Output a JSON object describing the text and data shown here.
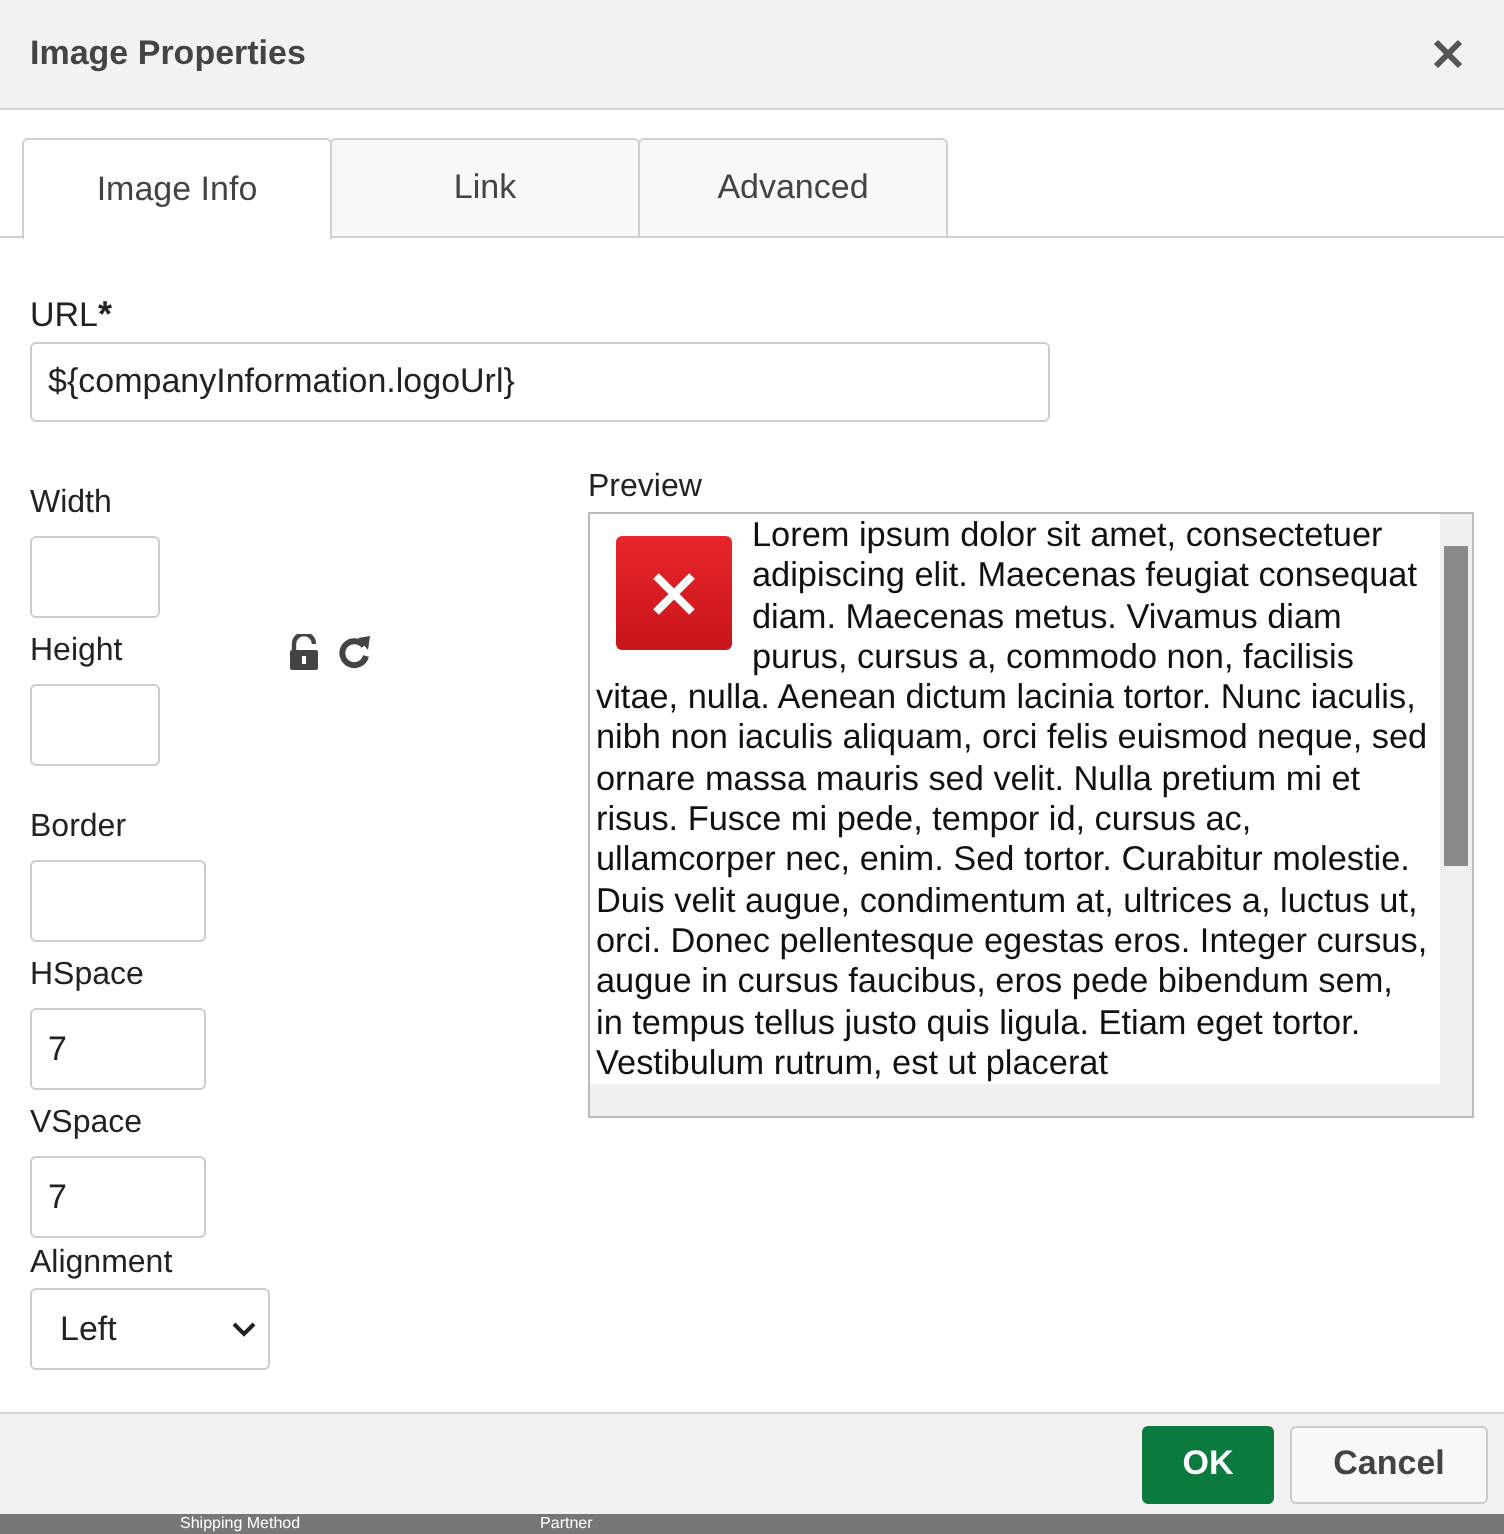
{
  "window": {
    "title": "Image Properties"
  },
  "tabs": [
    {
      "label": "Image Info",
      "selected": true
    },
    {
      "label": "Link",
      "selected": false
    },
    {
      "label": "Advanced",
      "selected": false
    }
  ],
  "url": {
    "label": "URL",
    "required_mark": "*",
    "value": "${companyInformation.logoUrl}"
  },
  "fields": [
    {
      "label": "Width"
    },
    {
      "label": "Height"
    },
    {
      "label": "Border"
    },
    {
      "label": "HSpace",
      "value": "7"
    },
    {
      "label": "VSpace",
      "value": "7"
    }
  ],
  "alignment": {
    "label": "Alignment",
    "value": "Left"
  },
  "preview": {
    "label": "Preview",
    "text_beside_image": "Lorem ipsum dolor sit amet, consectetuer adipiscing elit. Maecenas feugiat consequat diam. Maecenas metus. Vivamus diam purus, cursus a, commodo non, facilisis",
    "text_below_image": "vitae, nulla. Aenean dictum lacinia tortor. Nunc iaculis, nibh non iaculis aliquam, orci felis euismod neque, sed ornare massa mauris sed velit. Nulla pretium mi et risus. Fusce mi pede, tempor id, cursus ac, ullamcorper nec, enim. Sed tortor. Curabitur molestie. Duis velit augue, condimentum at, ultrices a, luctus ut, orci. Donec pellentesque egestas eros. Integer cursus, augue in cursus faucibus, eros pede bibendum sem, in tempus tellus justo quis ligula. Etiam eget tortor. Vestibulum rutrum, est ut placerat"
  },
  "buttons": [
    {
      "label": "OK",
      "kind": "primary"
    },
    {
      "label": "Cancel",
      "kind": "secondary"
    }
  ],
  "background_columns": [
    "Shipping Method",
    "Partner"
  ]
}
